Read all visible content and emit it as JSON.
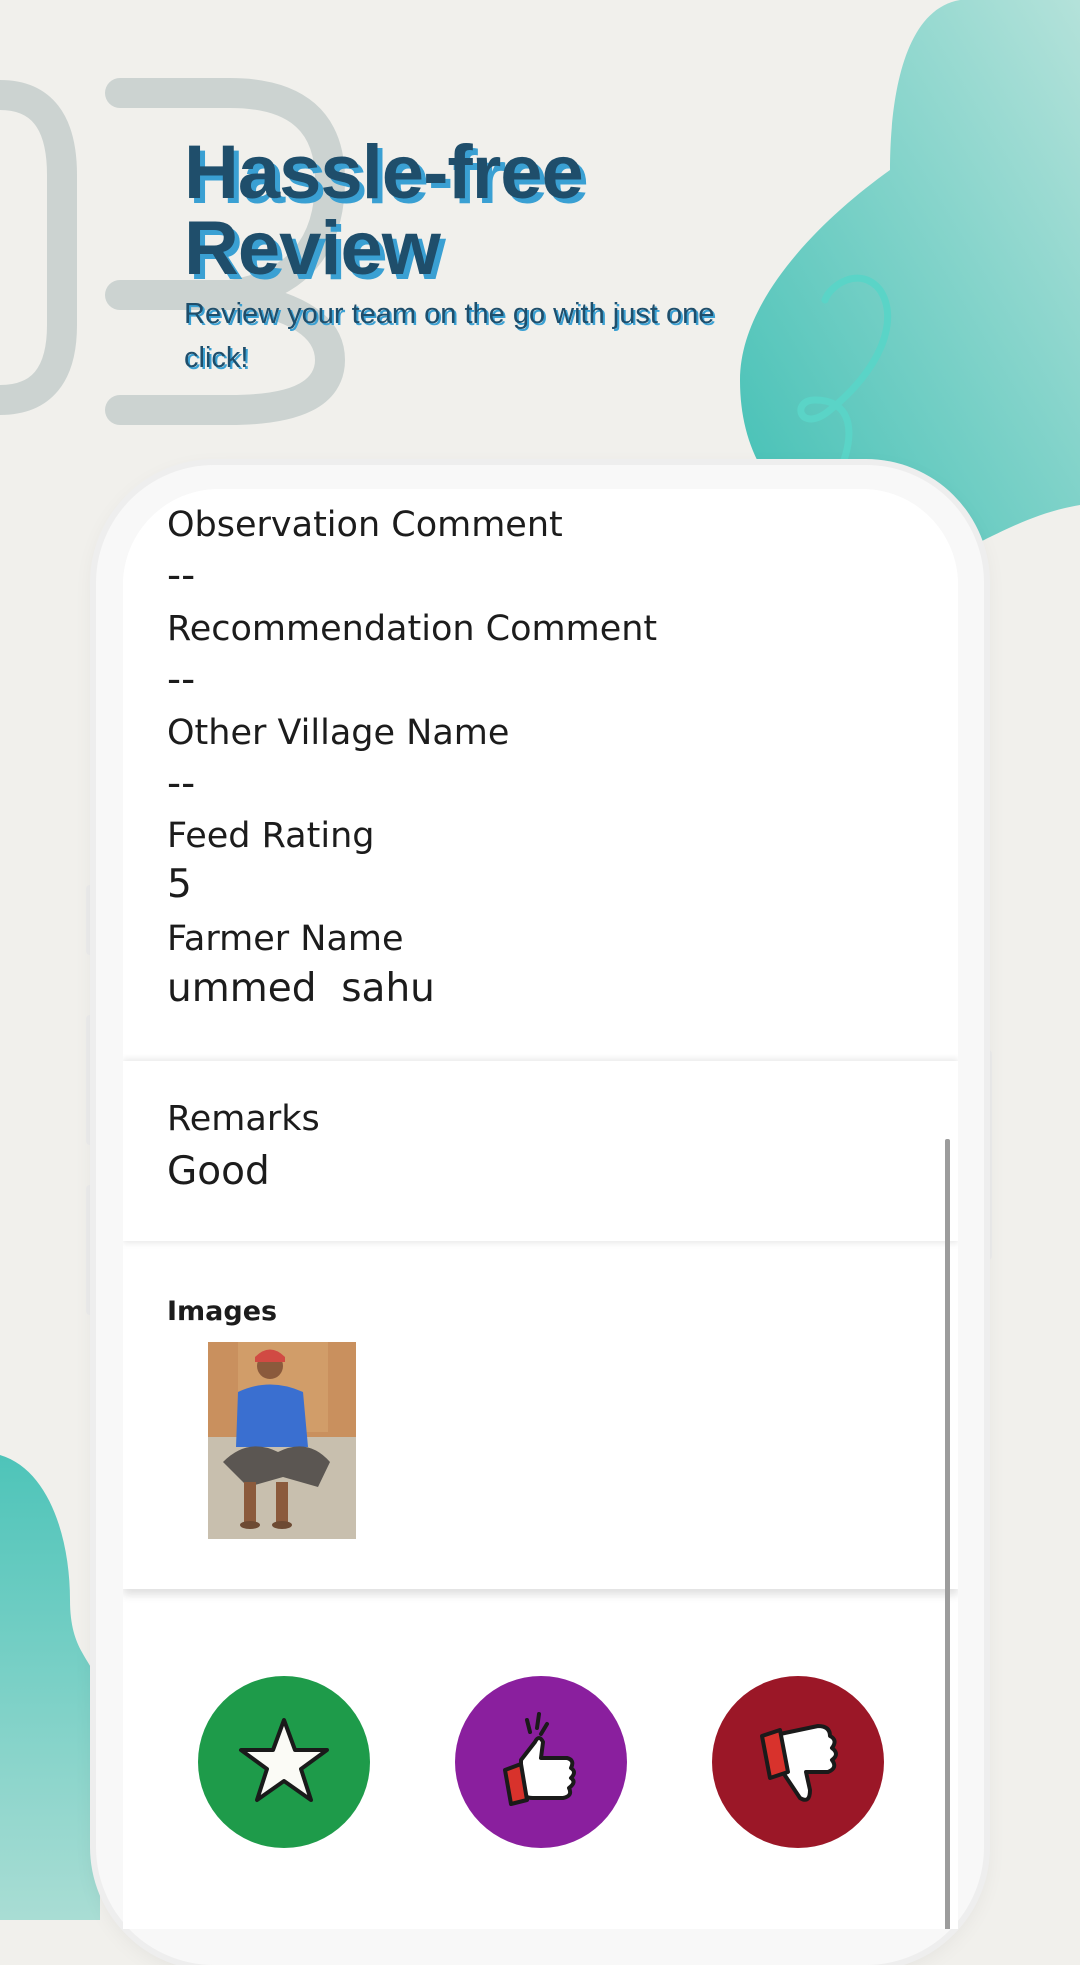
{
  "headline": {
    "line1": "Hassle-free",
    "line2": "Review"
  },
  "subline": "Review your team on the go with just one click!",
  "details": {
    "observation": {
      "label": "Observation Comment",
      "value": "--"
    },
    "recommendation": {
      "label": "Recommendation Comment",
      "value": "--"
    },
    "village": {
      "label": "Other Village Name",
      "value": "--"
    },
    "feed_rating": {
      "label": "Feed Rating",
      "value": "5"
    },
    "farmer": {
      "label": "Farmer Name",
      "value": "ummed  sahu"
    }
  },
  "remarks": {
    "label": "Remarks",
    "value": "Good"
  },
  "images": {
    "label": "Images"
  },
  "actions": [
    {
      "icon": "star-icon",
      "color": "#1e9b4a"
    },
    {
      "icon": "thumbs-up-icon",
      "color": "#8a1f9e"
    },
    {
      "icon": "thumbs-down-icon",
      "color": "#9b1727"
    }
  ],
  "colors": {
    "teal": "#4fc3ba",
    "headline": "#1f4e6b",
    "headline_shadow": "#3aa0d3",
    "background": "#f1f0ec"
  }
}
